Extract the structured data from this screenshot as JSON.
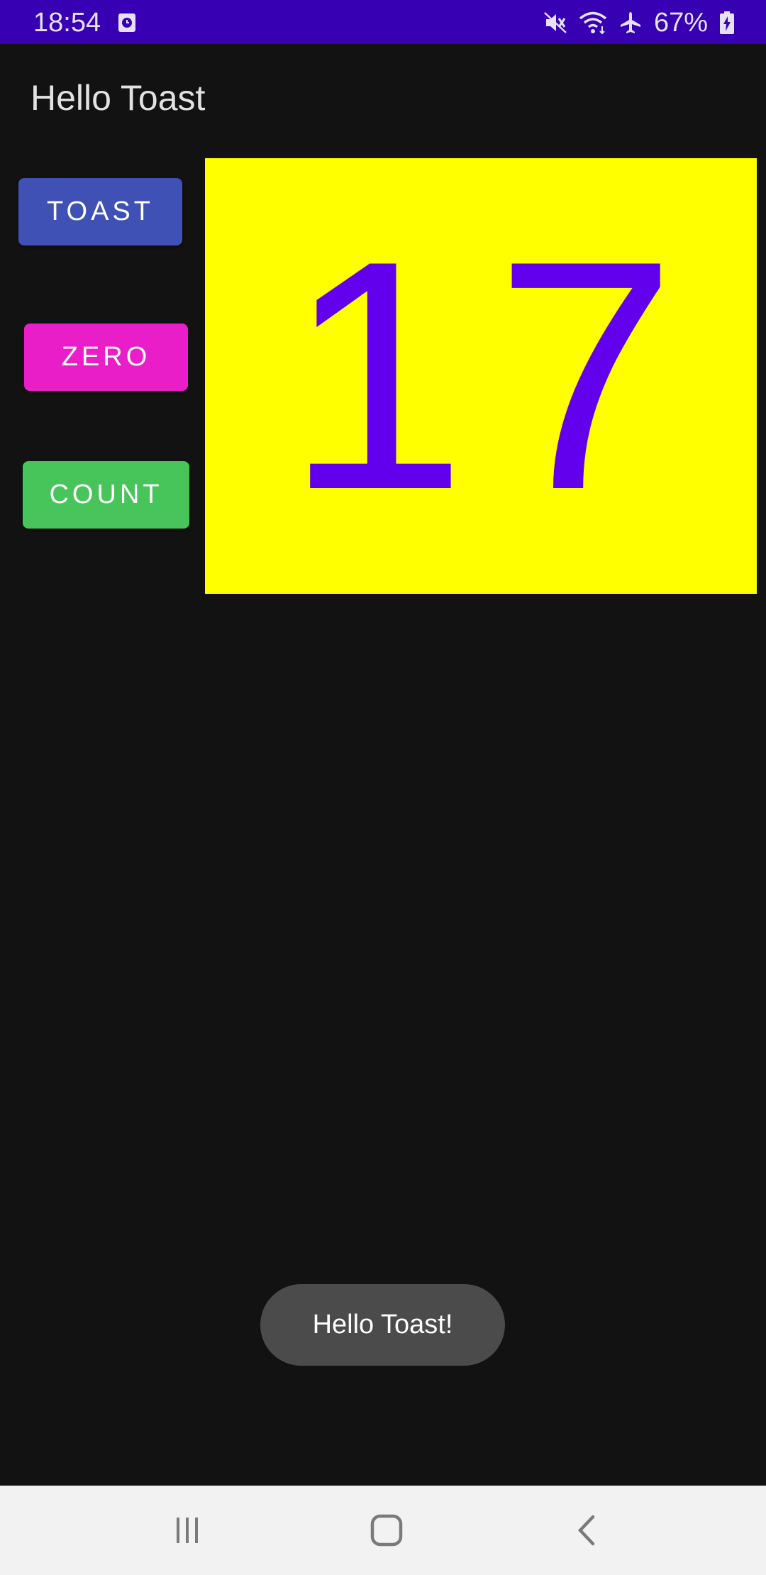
{
  "status_bar": {
    "time": "18:54",
    "battery": "67%",
    "icons": [
      "notification-icon",
      "mute-icon",
      "wifi-icon",
      "airplane-icon",
      "battery-charging-icon"
    ],
    "background": "#3700b3"
  },
  "app_bar": {
    "title": "Hello Toast"
  },
  "buttons": {
    "toast": {
      "label": "TOAST",
      "color": "#3f51b5"
    },
    "zero": {
      "label": "ZERO",
      "color": "#e91ec8"
    },
    "count": {
      "label": "COUNT",
      "color": "#47c45a"
    }
  },
  "count_display": {
    "value": "17",
    "text_color": "#6200ee",
    "background": "#ffff00"
  },
  "toast": {
    "message": "Hello Toast!"
  },
  "nav_bar": {
    "items": [
      "recents-icon",
      "home-icon",
      "back-icon"
    ]
  }
}
